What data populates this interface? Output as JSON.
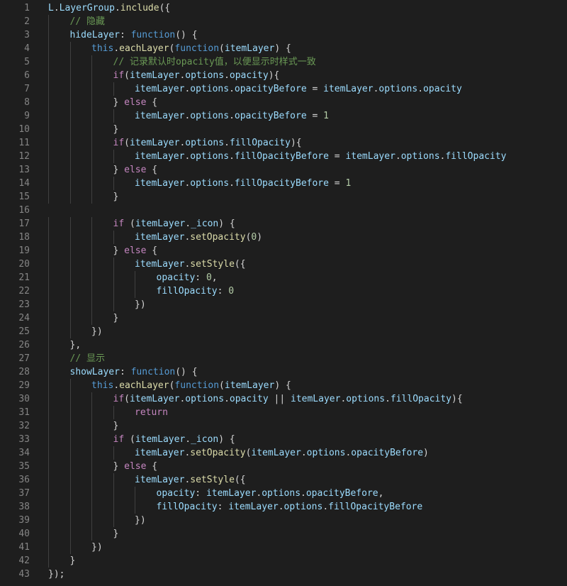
{
  "editor": {
    "colors": {
      "background": "#1e1e1e",
      "line_number": "#858585",
      "keyword": "#569cd6",
      "control": "#c586c0",
      "variable": "#9cdcfe",
      "function": "#dcdcaa",
      "number": "#b5cea8",
      "comment": "#6a9955",
      "punctuation": "#d4d4d4",
      "type": "#4ec9b0"
    },
    "lines": [
      {
        "n": "1",
        "indent": 0,
        "tokens": [
          [
            "var",
            "L"
          ],
          [
            "punc",
            "."
          ],
          [
            "var",
            "LayerGroup"
          ],
          [
            "punc",
            "."
          ],
          [
            "fn",
            "include"
          ],
          [
            "punc",
            "({"
          ]
        ]
      },
      {
        "n": "2",
        "indent": 1,
        "tokens": [
          [
            "cmt",
            "// 隐藏"
          ]
        ]
      },
      {
        "n": "3",
        "indent": 1,
        "tokens": [
          [
            "var",
            "hideLayer"
          ],
          [
            "punc",
            ": "
          ],
          [
            "kw",
            "function"
          ],
          [
            "punc",
            "() {"
          ]
        ]
      },
      {
        "n": "4",
        "indent": 2,
        "tokens": [
          [
            "kw",
            "this"
          ],
          [
            "punc",
            "."
          ],
          [
            "fn",
            "eachLayer"
          ],
          [
            "punc",
            "("
          ],
          [
            "kw",
            "function"
          ],
          [
            "punc",
            "("
          ],
          [
            "var",
            "itemLayer"
          ],
          [
            "punc",
            ") {"
          ]
        ]
      },
      {
        "n": "5",
        "indent": 3,
        "tokens": [
          [
            "cmt",
            "// 记录默认时opacity值，以便显示时样式一致"
          ]
        ]
      },
      {
        "n": "6",
        "indent": 3,
        "tokens": [
          [
            "ctl",
            "if"
          ],
          [
            "punc",
            "("
          ],
          [
            "var",
            "itemLayer"
          ],
          [
            "punc",
            "."
          ],
          [
            "var",
            "options"
          ],
          [
            "punc",
            "."
          ],
          [
            "var",
            "opacity"
          ],
          [
            "punc",
            "){"
          ]
        ]
      },
      {
        "n": "7",
        "indent": 4,
        "tokens": [
          [
            "var",
            "itemLayer"
          ],
          [
            "punc",
            "."
          ],
          [
            "var",
            "options"
          ],
          [
            "punc",
            "."
          ],
          [
            "var",
            "opacityBefore"
          ],
          [
            "punc",
            " = "
          ],
          [
            "var",
            "itemLayer"
          ],
          [
            "punc",
            "."
          ],
          [
            "var",
            "options"
          ],
          [
            "punc",
            "."
          ],
          [
            "var",
            "opacity"
          ]
        ]
      },
      {
        "n": "8",
        "indent": 3,
        "tokens": [
          [
            "punc",
            "} "
          ],
          [
            "ctl",
            "else"
          ],
          [
            "punc",
            " {"
          ]
        ]
      },
      {
        "n": "9",
        "indent": 4,
        "tokens": [
          [
            "var",
            "itemLayer"
          ],
          [
            "punc",
            "."
          ],
          [
            "var",
            "options"
          ],
          [
            "punc",
            "."
          ],
          [
            "var",
            "opacityBefore"
          ],
          [
            "punc",
            " = "
          ],
          [
            "num",
            "1"
          ]
        ]
      },
      {
        "n": "10",
        "indent": 3,
        "tokens": [
          [
            "punc",
            "}"
          ]
        ]
      },
      {
        "n": "11",
        "indent": 3,
        "tokens": [
          [
            "ctl",
            "if"
          ],
          [
            "punc",
            "("
          ],
          [
            "var",
            "itemLayer"
          ],
          [
            "punc",
            "."
          ],
          [
            "var",
            "options"
          ],
          [
            "punc",
            "."
          ],
          [
            "var",
            "fillOpacity"
          ],
          [
            "punc",
            "){"
          ]
        ]
      },
      {
        "n": "12",
        "indent": 4,
        "tokens": [
          [
            "var",
            "itemLayer"
          ],
          [
            "punc",
            "."
          ],
          [
            "var",
            "options"
          ],
          [
            "punc",
            "."
          ],
          [
            "var",
            "fillOpacityBefore"
          ],
          [
            "punc",
            " = "
          ],
          [
            "var",
            "itemLayer"
          ],
          [
            "punc",
            "."
          ],
          [
            "var",
            "options"
          ],
          [
            "punc",
            "."
          ],
          [
            "var",
            "fillOpacity"
          ]
        ]
      },
      {
        "n": "13",
        "indent": 3,
        "tokens": [
          [
            "punc",
            "} "
          ],
          [
            "ctl",
            "else"
          ],
          [
            "punc",
            " {"
          ]
        ]
      },
      {
        "n": "14",
        "indent": 4,
        "tokens": [
          [
            "var",
            "itemLayer"
          ],
          [
            "punc",
            "."
          ],
          [
            "var",
            "options"
          ],
          [
            "punc",
            "."
          ],
          [
            "var",
            "fillOpacityBefore"
          ],
          [
            "punc",
            " = "
          ],
          [
            "num",
            "1"
          ]
        ]
      },
      {
        "n": "15",
        "indent": 3,
        "tokens": [
          [
            "punc",
            "}"
          ]
        ]
      },
      {
        "n": "16",
        "indent": 0,
        "tokens": []
      },
      {
        "n": "17",
        "indent": 3,
        "tokens": [
          [
            "ctl",
            "if"
          ],
          [
            "punc",
            " ("
          ],
          [
            "var",
            "itemLayer"
          ],
          [
            "punc",
            "."
          ],
          [
            "var",
            "_icon"
          ],
          [
            "punc",
            ") {"
          ]
        ]
      },
      {
        "n": "18",
        "indent": 4,
        "tokens": [
          [
            "var",
            "itemLayer"
          ],
          [
            "punc",
            "."
          ],
          [
            "fn",
            "setOpacity"
          ],
          [
            "punc",
            "("
          ],
          [
            "num",
            "0"
          ],
          [
            "punc",
            ")"
          ]
        ]
      },
      {
        "n": "19",
        "indent": 3,
        "tokens": [
          [
            "punc",
            "} "
          ],
          [
            "ctl",
            "else"
          ],
          [
            "punc",
            " {"
          ]
        ]
      },
      {
        "n": "20",
        "indent": 4,
        "tokens": [
          [
            "var",
            "itemLayer"
          ],
          [
            "punc",
            "."
          ],
          [
            "fn",
            "setStyle"
          ],
          [
            "punc",
            "({"
          ]
        ]
      },
      {
        "n": "21",
        "indent": 5,
        "tokens": [
          [
            "var",
            "opacity"
          ],
          [
            "punc",
            ": "
          ],
          [
            "num",
            "0"
          ],
          [
            "punc",
            ","
          ]
        ]
      },
      {
        "n": "22",
        "indent": 5,
        "tokens": [
          [
            "var",
            "fillOpacity"
          ],
          [
            "punc",
            ": "
          ],
          [
            "num",
            "0"
          ]
        ]
      },
      {
        "n": "23",
        "indent": 4,
        "tokens": [
          [
            "punc",
            "})"
          ]
        ]
      },
      {
        "n": "24",
        "indent": 3,
        "tokens": [
          [
            "punc",
            "}"
          ]
        ]
      },
      {
        "n": "25",
        "indent": 2,
        "tokens": [
          [
            "punc",
            "})"
          ]
        ]
      },
      {
        "n": "26",
        "indent": 1,
        "tokens": [
          [
            "punc",
            "},"
          ]
        ]
      },
      {
        "n": "27",
        "indent": 1,
        "tokens": [
          [
            "cmt",
            "// 显示"
          ]
        ]
      },
      {
        "n": "28",
        "indent": 1,
        "tokens": [
          [
            "var",
            "showLayer"
          ],
          [
            "punc",
            ": "
          ],
          [
            "kw",
            "function"
          ],
          [
            "punc",
            "() {"
          ]
        ]
      },
      {
        "n": "29",
        "indent": 2,
        "tokens": [
          [
            "kw",
            "this"
          ],
          [
            "punc",
            "."
          ],
          [
            "fn",
            "eachLayer"
          ],
          [
            "punc",
            "("
          ],
          [
            "kw",
            "function"
          ],
          [
            "punc",
            "("
          ],
          [
            "var",
            "itemLayer"
          ],
          [
            "punc",
            ") {"
          ]
        ]
      },
      {
        "n": "30",
        "indent": 3,
        "tokens": [
          [
            "ctl",
            "if"
          ],
          [
            "punc",
            "("
          ],
          [
            "var",
            "itemLayer"
          ],
          [
            "punc",
            "."
          ],
          [
            "var",
            "options"
          ],
          [
            "punc",
            "."
          ],
          [
            "var",
            "opacity"
          ],
          [
            "punc",
            " || "
          ],
          [
            "var",
            "itemLayer"
          ],
          [
            "punc",
            "."
          ],
          [
            "var",
            "options"
          ],
          [
            "punc",
            "."
          ],
          [
            "var",
            "fillOpacity"
          ],
          [
            "punc",
            "){"
          ]
        ]
      },
      {
        "n": "31",
        "indent": 4,
        "tokens": [
          [
            "ctl",
            "return"
          ]
        ]
      },
      {
        "n": "32",
        "indent": 3,
        "tokens": [
          [
            "punc",
            "}"
          ]
        ]
      },
      {
        "n": "33",
        "indent": 3,
        "tokens": [
          [
            "ctl",
            "if"
          ],
          [
            "punc",
            " ("
          ],
          [
            "var",
            "itemLayer"
          ],
          [
            "punc",
            "."
          ],
          [
            "var",
            "_icon"
          ],
          [
            "punc",
            ") {"
          ]
        ]
      },
      {
        "n": "34",
        "indent": 4,
        "tokens": [
          [
            "var",
            "itemLayer"
          ],
          [
            "punc",
            "."
          ],
          [
            "fn",
            "setOpacity"
          ],
          [
            "punc",
            "("
          ],
          [
            "var",
            "itemLayer"
          ],
          [
            "punc",
            "."
          ],
          [
            "var",
            "options"
          ],
          [
            "punc",
            "."
          ],
          [
            "var",
            "opacityBefore"
          ],
          [
            "punc",
            ")"
          ]
        ]
      },
      {
        "n": "35",
        "indent": 3,
        "tokens": [
          [
            "punc",
            "} "
          ],
          [
            "ctl",
            "else"
          ],
          [
            "punc",
            " {"
          ]
        ]
      },
      {
        "n": "36",
        "indent": 4,
        "tokens": [
          [
            "var",
            "itemLayer"
          ],
          [
            "punc",
            "."
          ],
          [
            "fn",
            "setStyle"
          ],
          [
            "punc",
            "({"
          ]
        ]
      },
      {
        "n": "37",
        "indent": 5,
        "tokens": [
          [
            "var",
            "opacity"
          ],
          [
            "punc",
            ": "
          ],
          [
            "var",
            "itemLayer"
          ],
          [
            "punc",
            "."
          ],
          [
            "var",
            "options"
          ],
          [
            "punc",
            "."
          ],
          [
            "var",
            "opacityBefore"
          ],
          [
            "punc",
            ","
          ]
        ]
      },
      {
        "n": "38",
        "indent": 5,
        "tokens": [
          [
            "var",
            "fillOpacity"
          ],
          [
            "punc",
            ": "
          ],
          [
            "var",
            "itemLayer"
          ],
          [
            "punc",
            "."
          ],
          [
            "var",
            "options"
          ],
          [
            "punc",
            "."
          ],
          [
            "var",
            "fillOpacityBefore"
          ]
        ]
      },
      {
        "n": "39",
        "indent": 4,
        "tokens": [
          [
            "punc",
            "})"
          ]
        ]
      },
      {
        "n": "40",
        "indent": 3,
        "tokens": [
          [
            "punc",
            "}"
          ]
        ]
      },
      {
        "n": "41",
        "indent": 2,
        "tokens": [
          [
            "punc",
            "})"
          ]
        ]
      },
      {
        "n": "42",
        "indent": 1,
        "tokens": [
          [
            "punc",
            "}"
          ]
        ]
      },
      {
        "n": "43",
        "indent": 0,
        "tokens": [
          [
            "punc",
            "});"
          ]
        ]
      }
    ]
  }
}
